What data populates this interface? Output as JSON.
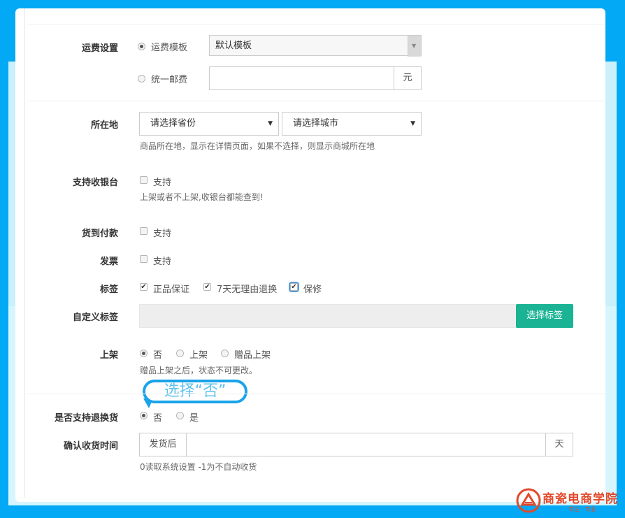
{
  "shipping": {
    "label": "运费设置",
    "option_template": "运费模板",
    "template_value": "默认模板",
    "option_flat": "统一邮费",
    "flat_value": "",
    "unit": "元"
  },
  "location": {
    "label": "所在地",
    "province_placeholder": "请选择省份",
    "city_placeholder": "请选择城市",
    "help": "商品所在地，显示在详情页面，如果不选择，则显示商城所在地"
  },
  "cashier": {
    "label": "支持收银台",
    "option": "支持",
    "help": "上架或者不上架,收银台都能查到!"
  },
  "cod": {
    "label": "货到付款",
    "option": "支持"
  },
  "invoice": {
    "label": "发票",
    "option": "支持"
  },
  "tags": {
    "label": "标签",
    "items": [
      {
        "text": "正品保证",
        "checked": true
      },
      {
        "text": "7天无理由退换",
        "checked": true
      },
      {
        "text": "保修",
        "checked": true
      }
    ]
  },
  "custom_tags": {
    "label": "自定义标签",
    "value": "",
    "button": "选择标签"
  },
  "listing": {
    "label": "上架",
    "options": [
      "否",
      "上架",
      "赠品上架"
    ],
    "selected": "否",
    "help": "赠品上架之后，状态不可更改。"
  },
  "annotation": {
    "text": "选择“否”"
  },
  "returns": {
    "label": "是否支持退换货",
    "options": [
      "否",
      "是"
    ],
    "selected": "否"
  },
  "confirm": {
    "label": "确认收货时间",
    "prefix": "发货后",
    "value": "",
    "suffix": "天",
    "help": "0读取系统设置 -1为不自动收货"
  },
  "watermark": {
    "text": "商瓷电商学院",
    "sub": "专注 · 专业"
  },
  "colors": {
    "frame": "#03a9f4",
    "button": "#1ab394",
    "bubble": "#1aa3e8",
    "logo": "#e2492b"
  }
}
